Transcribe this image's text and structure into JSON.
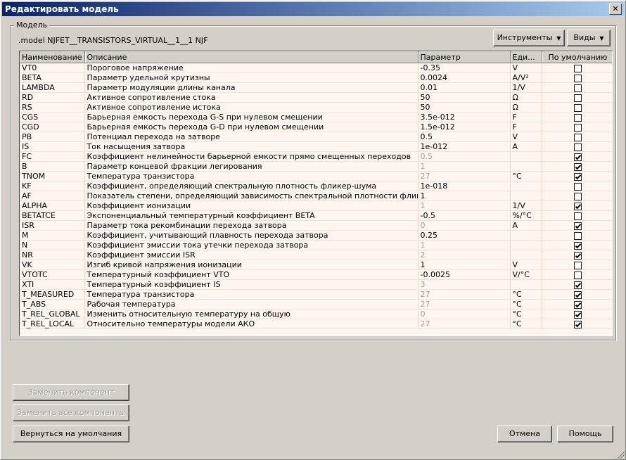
{
  "window": {
    "title": "Редактировать модель",
    "close_glyph": "✕"
  },
  "group": {
    "legend": "Модель"
  },
  "model_line": ".model NJFET__TRANSISTORS_VIRTUAL__1__1 NJF",
  "toolbar": {
    "tools_label": "Инструменты",
    "views_label": "Виды"
  },
  "table": {
    "columns": [
      "Наименование",
      "Описание",
      "Параметр",
      "Еди...",
      "По умолчанию"
    ],
    "rows": [
      {
        "name": "VT0",
        "desc": "Пороговое напряжение",
        "value": "-0.35",
        "unit": "V",
        "default": false
      },
      {
        "name": "BETA",
        "desc": "Параметр удельной крутизны",
        "value": "0.0024",
        "unit": "A/V²",
        "default": false
      },
      {
        "name": "LAMBDA",
        "desc": "Параметр модуляции длины канала",
        "value": "0.01",
        "unit": "1/V",
        "default": false
      },
      {
        "name": "RD",
        "desc": "Активное сопротивление стока",
        "value": "50",
        "unit": "Ω",
        "default": false
      },
      {
        "name": "RS",
        "desc": "Активное сопротивление истока",
        "value": "50",
        "unit": "Ω",
        "default": false
      },
      {
        "name": "CGS",
        "desc": "Барьерная емкость перехода G-S при нулевом смещении",
        "value": "3.5e-012",
        "unit": "F",
        "default": false
      },
      {
        "name": "CGD",
        "desc": "Барьерная емкость перехода G-D при нулевом смещении",
        "value": "1.5e-012",
        "unit": "F",
        "default": false
      },
      {
        "name": "PB",
        "desc": "Потенциал перехода на затворе",
        "value": "0.5",
        "unit": "V",
        "default": false
      },
      {
        "name": "IS",
        "desc": "Ток насыщения затвора",
        "value": "1e-012",
        "unit": "A",
        "default": false
      },
      {
        "name": "FC",
        "desc": "Коэффициент нелинейности барьерной емкости прямо смещенных переходов",
        "value": "0.5",
        "unit": "",
        "default": true
      },
      {
        "name": "B",
        "desc": "Параметр концевой фракции легирования",
        "value": "1",
        "unit": "",
        "default": true
      },
      {
        "name": "TNOM",
        "desc": "Температура транзистора",
        "value": "27",
        "unit": "°C",
        "default": true
      },
      {
        "name": "KF",
        "desc": "Коэффициент, определяющий спектральную плотность фликер-шума",
        "value": "1e-018",
        "unit": "",
        "default": false
      },
      {
        "name": "AF",
        "desc": "Показатель степени, определяющий зависимость спектральной плотности фликер-шума",
        "value": "1",
        "unit": "",
        "default": false
      },
      {
        "name": "ALPHA",
        "desc": "Коэффициент ионизации",
        "value": "1",
        "unit": "1/V",
        "default": true
      },
      {
        "name": "BETATCE",
        "desc": "Экспоненциальный температурный коэффициент BETA",
        "value": "-0.5",
        "unit": "%/°C",
        "default": false
      },
      {
        "name": "ISR",
        "desc": "Параметр тока рекомбинации перехода затвора",
        "value": "0",
        "unit": "A",
        "default": true
      },
      {
        "name": "M",
        "desc": "Коэффициент, учитывающий плавность перехода затвора",
        "value": "0.25",
        "unit": "",
        "default": false
      },
      {
        "name": "N",
        "desc": "Коэффициент эмиссии тока утечки перехода затвора",
        "value": "1",
        "unit": "",
        "default": true
      },
      {
        "name": "NR",
        "desc": "Коэффициент эмиссии ISR",
        "value": "2",
        "unit": "",
        "default": true
      },
      {
        "name": "VK",
        "desc": "Изгиб кривой напряжения ионизации",
        "value": "1",
        "unit": "V",
        "default": false
      },
      {
        "name": "VTOTC",
        "desc": "Температурный коэффициент VTO",
        "value": "-0.0025",
        "unit": "V/°C",
        "default": false
      },
      {
        "name": "XTI",
        "desc": "Температурный коэффициент IS",
        "value": "3",
        "unit": "",
        "default": true
      },
      {
        "name": "T_MEASURED",
        "desc": "Температура транзистора",
        "value": "27",
        "unit": "°C",
        "default": true
      },
      {
        "name": "T_ABS",
        "desc": "Рабочая температура",
        "value": "27",
        "unit": "°C",
        "default": true
      },
      {
        "name": "T_REL_GLOBAL",
        "desc": "Изменить относительную температуру на общую",
        "value": "0",
        "unit": "°C",
        "default": true
      },
      {
        "name": "T_REL_LOCAL",
        "desc": "Относительно температуры модели АКО",
        "value": "27",
        "unit": "°C",
        "default": true
      }
    ]
  },
  "buttons": {
    "replace_component": "Заменить компонент",
    "replace_all": "Заменить все компоненты",
    "reset_defaults": "Вернуться на умолчания",
    "cancel": "Отмена",
    "help": "Помощь"
  }
}
